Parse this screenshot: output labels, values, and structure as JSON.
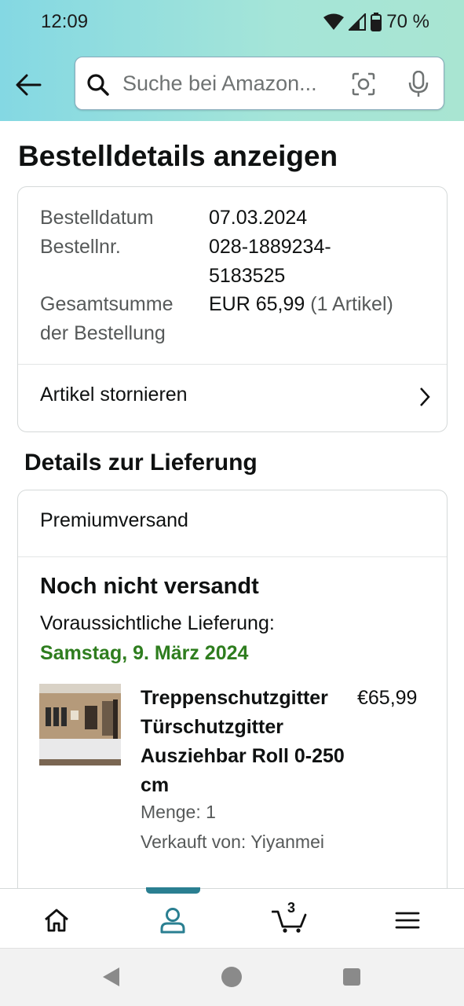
{
  "status_bar": {
    "time": "12:09",
    "battery": "70 %"
  },
  "search": {
    "placeholder": "Suche bei Amazon..."
  },
  "page": {
    "title": "Bestelldetails anzeigen"
  },
  "order": {
    "date_label": "Bestelldatum",
    "date_value": "07.03.2024",
    "number_label": "Bestellnr.",
    "number_value_1": "028-1889234-",
    "number_value_2": "5183525",
    "total_label_1": "Gesamtsumme",
    "total_label_2": "der Bestellung",
    "total_value": "EUR 65,99",
    "total_count": "(1 Artikel)",
    "cancel_label": "Artikel stornieren"
  },
  "delivery": {
    "section_title": "Details zur Lieferung",
    "method": "Premiumversand",
    "status": "Noch nicht versandt",
    "expected_label": "Voraussichtliche Lieferung:",
    "expected_date": "Samstag, 9. März 2024",
    "colors": {
      "expected_date": "#2e7d1e"
    },
    "item": {
      "title": "Treppenschutzgitter Türschutzgitter Ausziehbar Roll 0-250 cm",
      "price": "€65,99",
      "quantity": "Menge: 1",
      "seller": "Verkauft von: Yiyanmei"
    }
  },
  "bottom_nav": {
    "active": "account",
    "cart_count": "3",
    "items": [
      "home-icon",
      "account-icon",
      "cart-icon",
      "menu-icon"
    ],
    "colors": {
      "active": "#2a7f91"
    }
  }
}
